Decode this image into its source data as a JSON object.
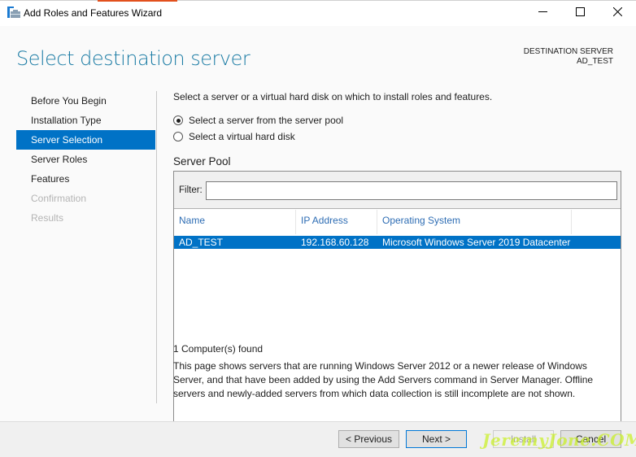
{
  "window": {
    "title": "Add Roles and Features Wizard",
    "icons": {
      "app": "server-manager-icon",
      "minimize": "minimize-icon",
      "maximize": "maximize-icon",
      "close": "close-icon"
    }
  },
  "header": {
    "title": "Select destination server",
    "destination_label": "DESTINATION SERVER",
    "destination_value": "AD_TEST"
  },
  "sidebar": {
    "items": [
      {
        "label": "Before You Begin",
        "state": "normal"
      },
      {
        "label": "Installation Type",
        "state": "normal"
      },
      {
        "label": "Server Selection",
        "state": "active"
      },
      {
        "label": "Server Roles",
        "state": "normal"
      },
      {
        "label": "Features",
        "state": "normal"
      },
      {
        "label": "Confirmation",
        "state": "disabled"
      },
      {
        "label": "Results",
        "state": "disabled"
      }
    ]
  },
  "main": {
    "intro": "Select a server or a virtual hard disk on which to install roles and features.",
    "options": [
      {
        "label": "Select a server from the server pool",
        "checked": true
      },
      {
        "label": "Select a virtual hard disk",
        "checked": false
      }
    ],
    "pool": {
      "title": "Server Pool",
      "filter_label": "Filter:",
      "filter_value": "",
      "columns": [
        "Name",
        "IP Address",
        "Operating System"
      ],
      "rows": [
        {
          "name": "AD_TEST",
          "ip": "192.168.60.128",
          "os": "Microsoft Windows Server 2019 Datacenter",
          "selected": true
        }
      ]
    },
    "found": "1 Computer(s) found",
    "description": "This page shows servers that are running Windows Server 2012 or a newer release of Windows Server, and that have been added by using the Add Servers command in Server Manager. Offline servers and newly-added servers from which data collection is still incomplete are not shown."
  },
  "footer": {
    "previous": "< Previous",
    "next": "Next >",
    "install": "Install",
    "cancel": "Cancel",
    "watermark": "JeremyJone.COM"
  },
  "colors": {
    "accent": "#0072c6",
    "title": "#1a7ba4",
    "column_header": "#2e6db4"
  }
}
